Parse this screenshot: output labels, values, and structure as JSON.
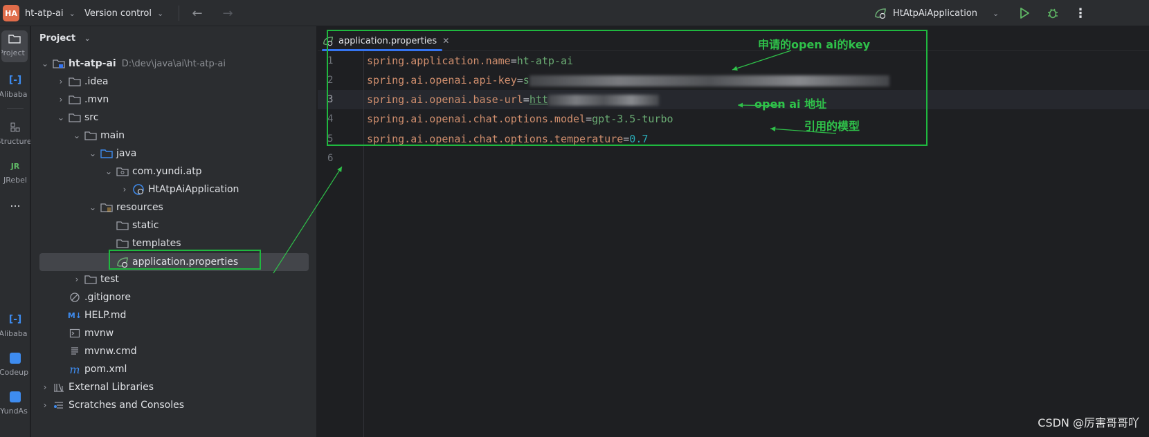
{
  "titlebar": {
    "project_badge": "HA",
    "project_name": "ht-atp-ai",
    "vcs_label": "Version control",
    "run_config": "HtAtpAiApplication"
  },
  "leftbar": {
    "items": [
      {
        "label": "Project"
      },
      {
        "label": "Alibaba"
      },
      {
        "label": "Structure"
      },
      {
        "label": "JRebel"
      },
      {
        "label": "..."
      },
      {
        "label": "Alibaba"
      },
      {
        "label": "Codeup"
      },
      {
        "label": "YundAs"
      }
    ]
  },
  "panel": {
    "title": "Project",
    "tree": [
      {
        "label": "ht-atp-ai",
        "hint": "D:\\dev\\java\\ai\\ht-atp-ai"
      },
      {
        "label": ".idea"
      },
      {
        "label": ".mvn"
      },
      {
        "label": "src"
      },
      {
        "label": "main"
      },
      {
        "label": "java"
      },
      {
        "label": "com.yundi.atp"
      },
      {
        "label": "HtAtpAiApplication"
      },
      {
        "label": "resources"
      },
      {
        "label": "static"
      },
      {
        "label": "templates"
      },
      {
        "label": "application.properties"
      },
      {
        "label": "test"
      },
      {
        "label": ".gitignore"
      },
      {
        "label": "HELP.md"
      },
      {
        "label": "mvnw"
      },
      {
        "label": "mvnw.cmd"
      },
      {
        "label": "pom.xml"
      },
      {
        "label": "External Libraries"
      },
      {
        "label": "Scratches and Consoles"
      }
    ]
  },
  "editor": {
    "tab_label": "application.properties",
    "line_numbers": [
      "1",
      "2",
      "3",
      "4",
      "5",
      "6"
    ],
    "lines": [
      {
        "key": "spring.application.name",
        "value": "ht-atp-ai"
      },
      {
        "key": "spring.ai.openai.api-key",
        "value": "s"
      },
      {
        "key": "spring.ai.openai.base-url",
        "value": "htt"
      },
      {
        "key": "spring.ai.openai.chat.options.model",
        "value": "gpt-3.5-turbo"
      },
      {
        "key": "spring.ai.openai.chat.options.temperature",
        "value": "0.7"
      }
    ]
  },
  "annotations": {
    "api_key": "申请的open ai的key",
    "base_url": "open ai 地址",
    "model": "引用的模型"
  },
  "watermark": "CSDN @厉害哥哥吖",
  "colors": {
    "accent": "#3574f0",
    "annotation": "#2fc24a"
  }
}
